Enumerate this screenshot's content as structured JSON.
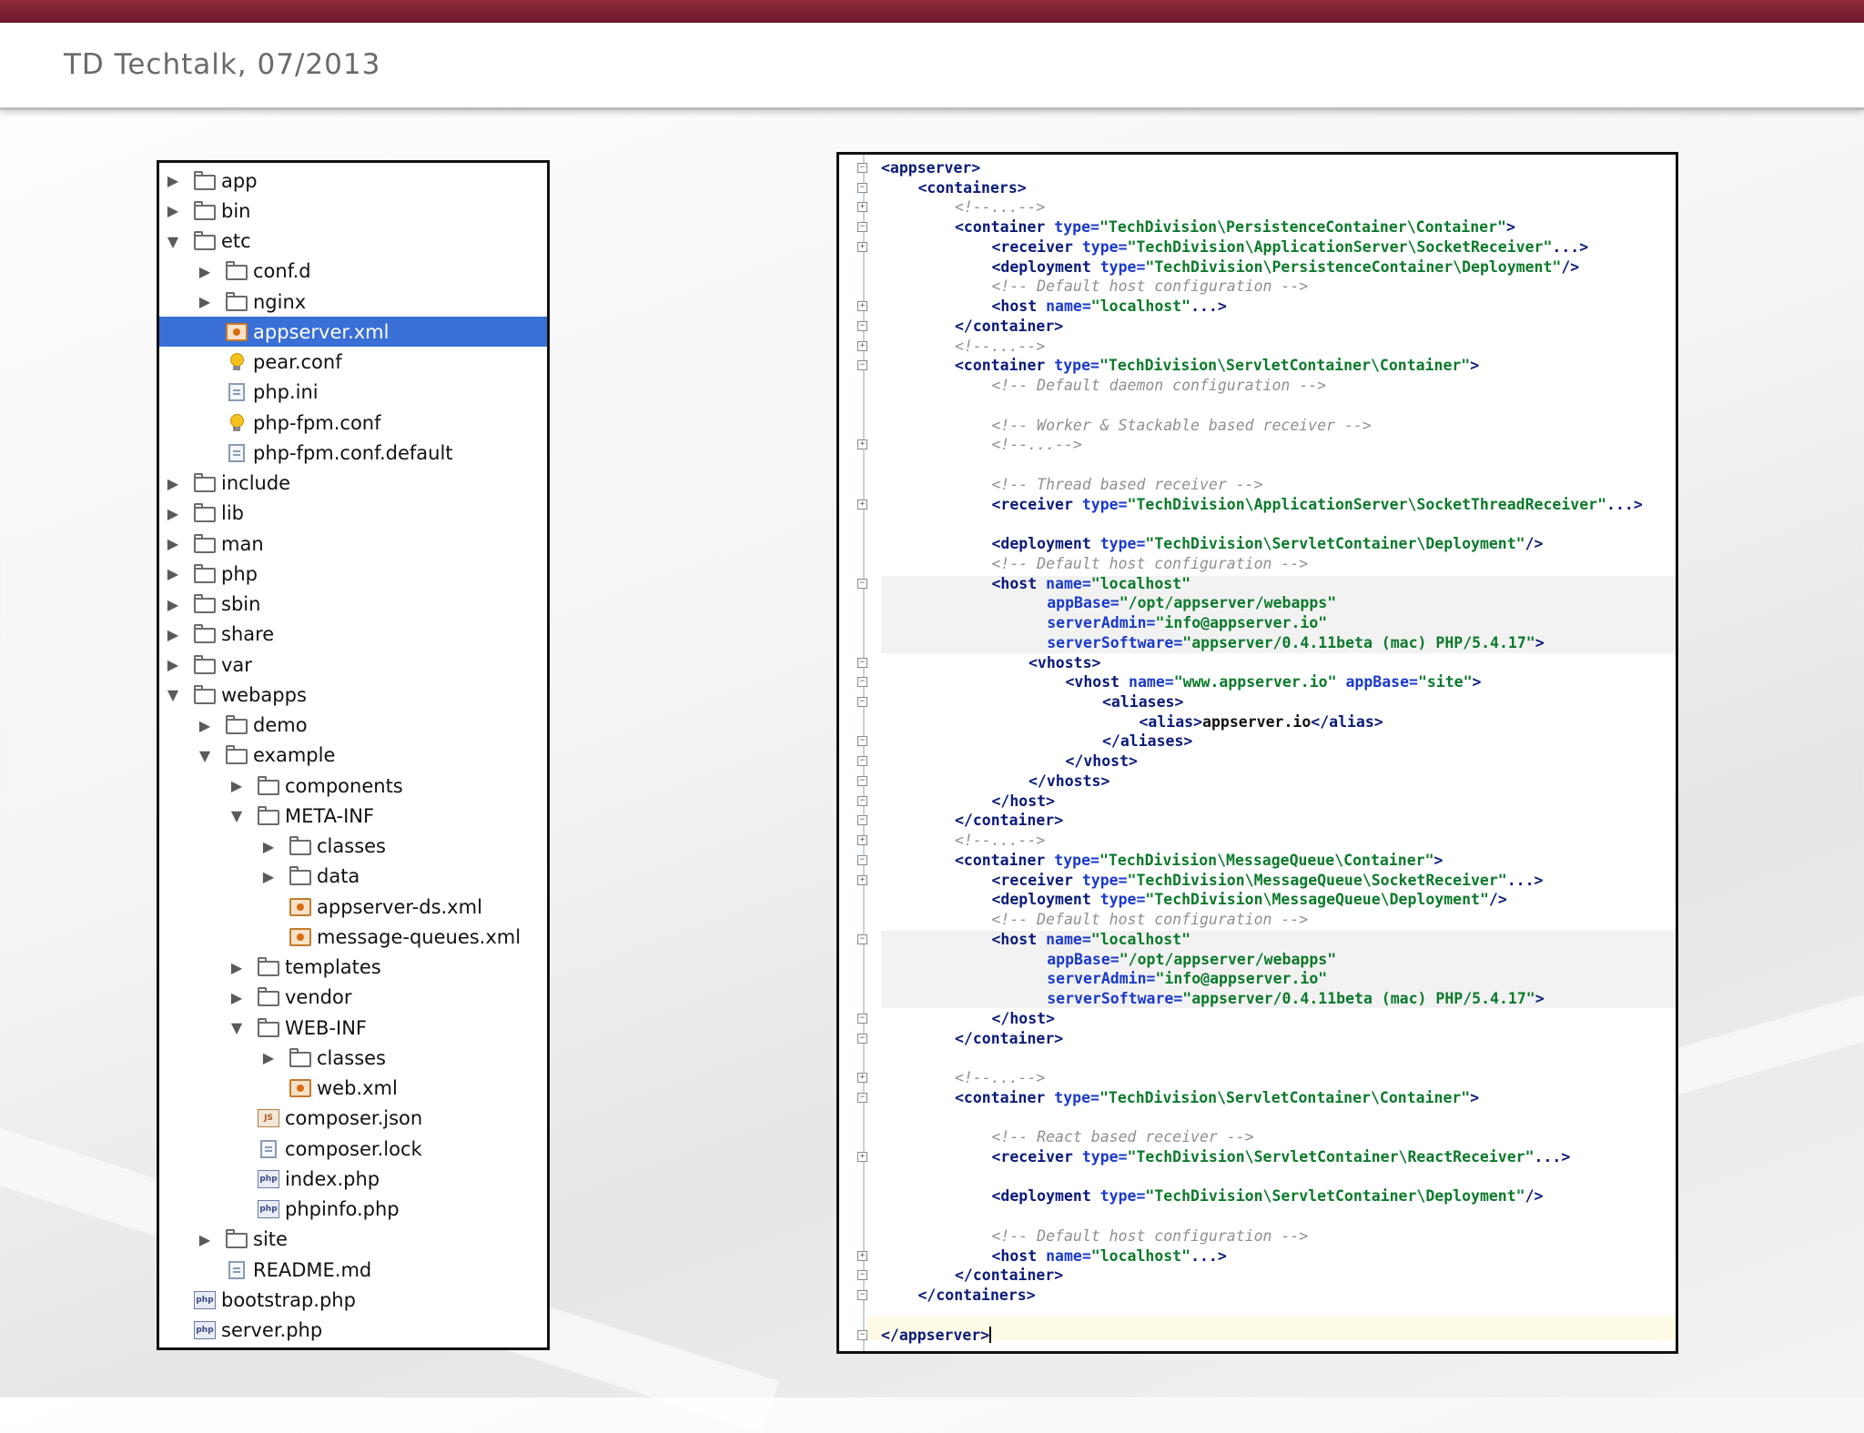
{
  "slide": {
    "title": "TD Techtalk, 07/2013"
  },
  "file_tree": [
    {
      "depth": 0,
      "arrow": "right",
      "icon": "folder-icon",
      "label": "app"
    },
    {
      "depth": 0,
      "arrow": "right",
      "icon": "folder-icon",
      "label": "bin"
    },
    {
      "depth": 0,
      "arrow": "down",
      "icon": "folder-icon",
      "label": "etc"
    },
    {
      "depth": 1,
      "arrow": "right",
      "icon": "folder-icon",
      "label": "conf.d"
    },
    {
      "depth": 1,
      "arrow": "right",
      "icon": "folder-icon",
      "label": "nginx"
    },
    {
      "depth": 1,
      "arrow": "none",
      "icon": "xml-file-icon",
      "label": "appserver.xml",
      "selected": true
    },
    {
      "depth": 1,
      "arrow": "none",
      "icon": "config-bulb-icon",
      "label": "pear.conf"
    },
    {
      "depth": 1,
      "arrow": "none",
      "icon": "text-file-icon",
      "label": "php.ini"
    },
    {
      "depth": 1,
      "arrow": "none",
      "icon": "config-bulb-icon",
      "label": "php-fpm.conf"
    },
    {
      "depth": 1,
      "arrow": "none",
      "icon": "text-file-icon",
      "label": "php-fpm.conf.default"
    },
    {
      "depth": 0,
      "arrow": "right",
      "icon": "folder-icon",
      "label": "include"
    },
    {
      "depth": 0,
      "arrow": "right",
      "icon": "folder-icon",
      "label": "lib"
    },
    {
      "depth": 0,
      "arrow": "right",
      "icon": "folder-icon",
      "label": "man"
    },
    {
      "depth": 0,
      "arrow": "right",
      "icon": "folder-icon",
      "label": "php"
    },
    {
      "depth": 0,
      "arrow": "right",
      "icon": "folder-icon",
      "label": "sbin"
    },
    {
      "depth": 0,
      "arrow": "right",
      "icon": "folder-icon",
      "label": "share"
    },
    {
      "depth": 0,
      "arrow": "right",
      "icon": "folder-icon",
      "label": "var"
    },
    {
      "depth": 0,
      "arrow": "down",
      "icon": "folder-icon",
      "label": "webapps"
    },
    {
      "depth": 1,
      "arrow": "right",
      "icon": "folder-icon",
      "label": "demo"
    },
    {
      "depth": 1,
      "arrow": "down",
      "icon": "folder-icon",
      "label": "example"
    },
    {
      "depth": 2,
      "arrow": "right",
      "icon": "folder-icon",
      "label": "components"
    },
    {
      "depth": 2,
      "arrow": "down",
      "icon": "folder-icon",
      "label": "META-INF"
    },
    {
      "depth": 3,
      "arrow": "right",
      "icon": "folder-icon",
      "label": "classes"
    },
    {
      "depth": 3,
      "arrow": "right",
      "icon": "folder-icon",
      "label": "data"
    },
    {
      "depth": 3,
      "arrow": "none",
      "icon": "xml-file-icon",
      "label": "appserver-ds.xml"
    },
    {
      "depth": 3,
      "arrow": "none",
      "icon": "xml-file-icon",
      "label": "message-queues.xml"
    },
    {
      "depth": 2,
      "arrow": "right",
      "icon": "folder-icon",
      "label": "templates"
    },
    {
      "depth": 2,
      "arrow": "right",
      "icon": "folder-icon",
      "label": "vendor"
    },
    {
      "depth": 2,
      "arrow": "down",
      "icon": "folder-icon",
      "label": "WEB-INF"
    },
    {
      "depth": 3,
      "arrow": "right",
      "icon": "folder-icon",
      "label": "classes"
    },
    {
      "depth": 3,
      "arrow": "none",
      "icon": "xml-file-icon",
      "label": "web.xml"
    },
    {
      "depth": 2,
      "arrow": "none",
      "icon": "json-file-icon",
      "label": "composer.json"
    },
    {
      "depth": 2,
      "arrow": "none",
      "icon": "text-file-icon",
      "label": "composer.lock"
    },
    {
      "depth": 2,
      "arrow": "none",
      "icon": "php-file-icon",
      "label": "index.php"
    },
    {
      "depth": 2,
      "arrow": "none",
      "icon": "php-file-icon",
      "label": "phpinfo.php"
    },
    {
      "depth": 1,
      "arrow": "right",
      "icon": "folder-icon",
      "label": "site"
    },
    {
      "depth": 1,
      "arrow": "none",
      "icon": "text-file-icon",
      "label": "README.md"
    },
    {
      "depth": 0,
      "arrow": "none",
      "icon": "php-file-icon",
      "label": "bootstrap.php"
    },
    {
      "depth": 0,
      "arrow": "none",
      "icon": "php-file-icon",
      "label": "server.php"
    }
  ],
  "code_lines": [
    {
      "indent": 0,
      "fold": "open",
      "segs": [
        [
          "tag",
          "<appserver>"
        ]
      ]
    },
    {
      "indent": 1,
      "fold": "open",
      "segs": [
        [
          "tag",
          "<containers>"
        ]
      ]
    },
    {
      "indent": 2,
      "fold": "plus",
      "segs": [
        [
          "cm",
          "<!--...-->"
        ]
      ]
    },
    {
      "indent": 2,
      "fold": "open",
      "segs": [
        [
          "tag",
          "<container "
        ],
        [
          "attr",
          "type="
        ],
        [
          "val",
          "\"TechDivision\\PersistenceContainer\\Container\""
        ],
        [
          "tag",
          ">"
        ]
      ]
    },
    {
      "indent": 3,
      "fold": "plus",
      "segs": [
        [
          "tag",
          "<receiver "
        ],
        [
          "attr",
          "type="
        ],
        [
          "val",
          "\"TechDivision\\ApplicationServer\\SocketReceiver\""
        ],
        [
          "tag",
          "...>"
        ]
      ]
    },
    {
      "indent": 3,
      "fold": "",
      "segs": [
        [
          "tag",
          "<deployment "
        ],
        [
          "attr",
          "type="
        ],
        [
          "val",
          "\"TechDivision\\PersistenceContainer\\Deployment\""
        ],
        [
          "tag",
          "/>"
        ]
      ]
    },
    {
      "indent": 3,
      "fold": "",
      "segs": [
        [
          "cm",
          "<!-- Default host configuration -->"
        ]
      ]
    },
    {
      "indent": 3,
      "fold": "plus",
      "segs": [
        [
          "tag",
          "<host "
        ],
        [
          "attr",
          "name="
        ],
        [
          "val",
          "\"localhost\""
        ],
        [
          "tag",
          "...>"
        ]
      ]
    },
    {
      "indent": 2,
      "fold": "close",
      "segs": [
        [
          "tag",
          "</container>"
        ]
      ]
    },
    {
      "indent": 2,
      "fold": "plus",
      "segs": [
        [
          "cm",
          "<!--...-->"
        ]
      ]
    },
    {
      "indent": 2,
      "fold": "open",
      "segs": [
        [
          "tag",
          "<container "
        ],
        [
          "attr",
          "type="
        ],
        [
          "val",
          "\"TechDivision\\ServletContainer\\Container\""
        ],
        [
          "tag",
          ">"
        ]
      ]
    },
    {
      "indent": 3,
      "fold": "",
      "segs": [
        [
          "cm",
          "<!-- Default daemon configuration -->"
        ]
      ]
    },
    {
      "indent": 0,
      "fold": "",
      "segs": []
    },
    {
      "indent": 3,
      "fold": "",
      "segs": [
        [
          "cm",
          "<!-- Worker & Stackable based receiver -->"
        ]
      ]
    },
    {
      "indent": 3,
      "fold": "plus",
      "segs": [
        [
          "cm",
          "<!--...-->"
        ]
      ]
    },
    {
      "indent": 0,
      "fold": "",
      "segs": []
    },
    {
      "indent": 3,
      "fold": "",
      "segs": [
        [
          "cm",
          "<!-- Thread based receiver -->"
        ]
      ]
    },
    {
      "indent": 3,
      "fold": "plus",
      "segs": [
        [
          "tag",
          "<receiver "
        ],
        [
          "attr",
          "type="
        ],
        [
          "val",
          "\"TechDivision\\ApplicationServer\\SocketThreadReceiver\""
        ],
        [
          "tag",
          "...>"
        ]
      ]
    },
    {
      "indent": 0,
      "fold": "",
      "segs": []
    },
    {
      "indent": 3,
      "fold": "",
      "segs": [
        [
          "tag",
          "<deployment "
        ],
        [
          "attr",
          "type="
        ],
        [
          "val",
          "\"TechDivision\\ServletContainer\\Deployment\""
        ],
        [
          "tag",
          "/>"
        ]
      ]
    },
    {
      "indent": 3,
      "fold": "",
      "segs": [
        [
          "cm",
          "<!-- Default host configuration -->"
        ]
      ]
    },
    {
      "indent": 3,
      "fold": "open",
      "segs": [
        [
          "tag",
          "<host "
        ],
        [
          "attr",
          "name="
        ],
        [
          "val",
          "\"localhost\""
        ]
      ]
    },
    {
      "indent": 4.5,
      "fold": "",
      "segs": [
        [
          "attr",
          "appBase="
        ],
        [
          "val",
          "\"/opt/appserver/webapps\""
        ]
      ]
    },
    {
      "indent": 4.5,
      "fold": "",
      "segs": [
        [
          "attr",
          "serverAdmin="
        ],
        [
          "val",
          "\"info@appserver.io\""
        ]
      ]
    },
    {
      "indent": 4.5,
      "fold": "",
      "segs": [
        [
          "attr",
          "serverSoftware="
        ],
        [
          "val",
          "\"appserver/0.4.11beta (mac) PHP/5.4.17\""
        ],
        [
          "tag",
          ">"
        ]
      ]
    },
    {
      "indent": 4,
      "fold": "open",
      "segs": [
        [
          "tag",
          "<vhosts>"
        ]
      ]
    },
    {
      "indent": 5,
      "fold": "open",
      "segs": [
        [
          "tag",
          "<vhost "
        ],
        [
          "attr",
          "name="
        ],
        [
          "val",
          "\"www.appserver.io\""
        ],
        [
          "attr",
          " appBase="
        ],
        [
          "val",
          "\"site\""
        ],
        [
          "tag",
          ">"
        ]
      ]
    },
    {
      "indent": 6,
      "fold": "open",
      "segs": [
        [
          "tag",
          "<aliases>"
        ]
      ]
    },
    {
      "indent": 7,
      "fold": "",
      "segs": [
        [
          "tag",
          "<alias>"
        ],
        [
          "txt",
          "appserver.io"
        ],
        [
          "tag",
          "</alias>"
        ]
      ]
    },
    {
      "indent": 6,
      "fold": "close",
      "segs": [
        [
          "tag",
          "</aliases>"
        ]
      ]
    },
    {
      "indent": 5,
      "fold": "close",
      "segs": [
        [
          "tag",
          "</vhost>"
        ]
      ]
    },
    {
      "indent": 4,
      "fold": "close",
      "segs": [
        [
          "tag",
          "</vhosts>"
        ]
      ]
    },
    {
      "indent": 3,
      "fold": "close",
      "segs": [
        [
          "tag",
          "</host>"
        ]
      ]
    },
    {
      "indent": 2,
      "fold": "close",
      "segs": [
        [
          "tag",
          "</container>"
        ]
      ]
    },
    {
      "indent": 2,
      "fold": "plus",
      "segs": [
        [
          "cm",
          "<!--...-->"
        ]
      ]
    },
    {
      "indent": 2,
      "fold": "open",
      "segs": [
        [
          "tag",
          "<container "
        ],
        [
          "attr",
          "type="
        ],
        [
          "val",
          "\"TechDivision\\MessageQueue\\Container\""
        ],
        [
          "tag",
          ">"
        ]
      ]
    },
    {
      "indent": 3,
      "fold": "plus",
      "segs": [
        [
          "tag",
          "<receiver "
        ],
        [
          "attr",
          "type="
        ],
        [
          "val",
          "\"TechDivision\\MessageQueue\\SocketReceiver\""
        ],
        [
          "tag",
          "...>"
        ]
      ]
    },
    {
      "indent": 3,
      "fold": "",
      "segs": [
        [
          "tag",
          "<deployment "
        ],
        [
          "attr",
          "type="
        ],
        [
          "val",
          "\"TechDivision\\MessageQueue\\Deployment\""
        ],
        [
          "tag",
          "/>"
        ]
      ]
    },
    {
      "indent": 3,
      "fold": "",
      "segs": [
        [
          "cm",
          "<!-- Default host configuration -->"
        ]
      ]
    },
    {
      "indent": 3,
      "fold": "open",
      "segs": [
        [
          "tag",
          "<host "
        ],
        [
          "attr",
          "name="
        ],
        [
          "val",
          "\"localhost\""
        ]
      ]
    },
    {
      "indent": 4.5,
      "fold": "",
      "segs": [
        [
          "attr",
          "appBase="
        ],
        [
          "val",
          "\"/opt/appserver/webapps\""
        ]
      ]
    },
    {
      "indent": 4.5,
      "fold": "",
      "segs": [
        [
          "attr",
          "serverAdmin="
        ],
        [
          "val",
          "\"info@appserver.io\""
        ]
      ]
    },
    {
      "indent": 4.5,
      "fold": "",
      "segs": [
        [
          "attr",
          "serverSoftware="
        ],
        [
          "val",
          "\"appserver/0.4.11beta (mac) PHP/5.4.17\""
        ],
        [
          "tag",
          ">"
        ]
      ]
    },
    {
      "indent": 3,
      "fold": "close",
      "segs": [
        [
          "tag",
          "</host>"
        ]
      ]
    },
    {
      "indent": 2,
      "fold": "close",
      "segs": [
        [
          "tag",
          "</container>"
        ]
      ]
    },
    {
      "indent": 0,
      "fold": "",
      "segs": []
    },
    {
      "indent": 2,
      "fold": "plus",
      "segs": [
        [
          "cm",
          "<!--...-->"
        ]
      ]
    },
    {
      "indent": 2,
      "fold": "open",
      "segs": [
        [
          "tag",
          "<container "
        ],
        [
          "attr",
          "type="
        ],
        [
          "val",
          "\"TechDivision\\ServletContainer\\Container\""
        ],
        [
          "tag",
          ">"
        ]
      ]
    },
    {
      "indent": 0,
      "fold": "",
      "segs": []
    },
    {
      "indent": 3,
      "fold": "",
      "segs": [
        [
          "cm",
          "<!-- React based receiver -->"
        ]
      ]
    },
    {
      "indent": 3,
      "fold": "plus",
      "segs": [
        [
          "tag",
          "<receiver "
        ],
        [
          "attr",
          "type="
        ],
        [
          "val",
          "\"TechDivision\\ServletContainer\\ReactReceiver\""
        ],
        [
          "tag",
          "...>"
        ]
      ]
    },
    {
      "indent": 0,
      "fold": "",
      "segs": []
    },
    {
      "indent": 3,
      "fold": "",
      "segs": [
        [
          "tag",
          "<deployment "
        ],
        [
          "attr",
          "type="
        ],
        [
          "val",
          "\"TechDivision\\ServletContainer\\Deployment\""
        ],
        [
          "tag",
          "/>"
        ]
      ]
    },
    {
      "indent": 0,
      "fold": "",
      "segs": []
    },
    {
      "indent": 3,
      "fold": "",
      "segs": [
        [
          "cm",
          "<!-- Default host configuration -->"
        ]
      ]
    },
    {
      "indent": 3,
      "fold": "plus",
      "segs": [
        [
          "tag",
          "<host "
        ],
        [
          "attr",
          "name="
        ],
        [
          "val",
          "\"localhost\""
        ],
        [
          "tag",
          "...>"
        ]
      ]
    },
    {
      "indent": 2,
      "fold": "close",
      "segs": [
        [
          "tag",
          "</container>"
        ]
      ]
    },
    {
      "indent": 1,
      "fold": "close",
      "segs": [
        [
          "tag",
          "</containers>"
        ]
      ]
    },
    {
      "indent": 0,
      "fold": "",
      "segs": []
    },
    {
      "indent": 0,
      "fold": "close",
      "caret": true,
      "segs": [
        [
          "tag",
          "</appserver>"
        ]
      ]
    }
  ],
  "colors": {
    "accent_bar": "#7d2233",
    "selection": "#3a6fd6",
    "tag": "#0a1a7a",
    "attr": "#1a3acb",
    "value": "#0b7a2a",
    "comment": "#8f8f8f"
  }
}
